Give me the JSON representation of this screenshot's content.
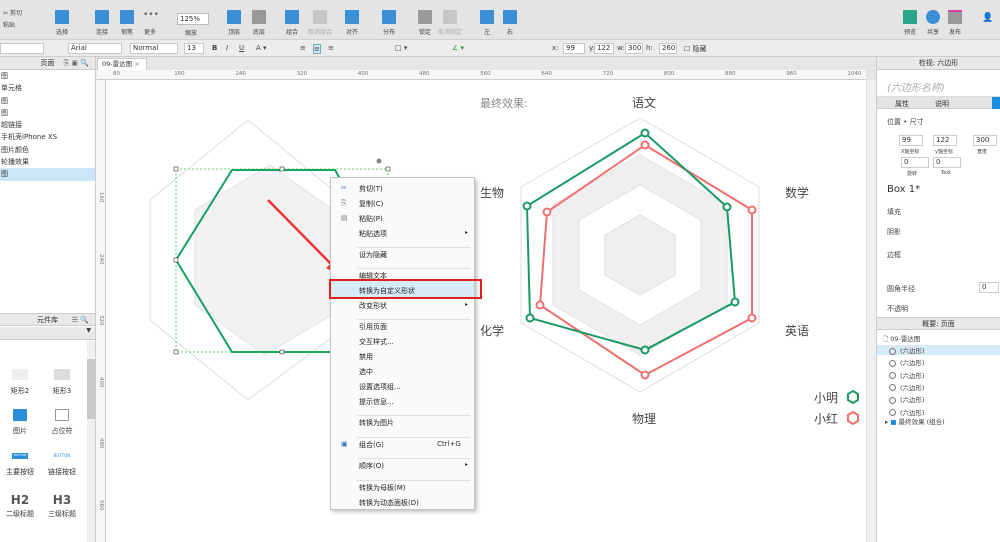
{
  "toolbar": {
    "items": [
      "选择",
      "连接",
      "钢笔",
      "更多",
      "缩放",
      "顶层",
      "底层",
      "组合",
      "取消组合",
      "对齐",
      "分布",
      "锁定",
      "取消锁定",
      "左",
      "右",
      "预览",
      "共享",
      "发布"
    ],
    "zoom": "125%",
    "edit_cut": "剪切",
    "edit_paste": "粘贴"
  },
  "format": {
    "font": "Arial",
    "weight": "Normal",
    "size": "13",
    "x_label": "x:",
    "x": "99",
    "y_label": "y:",
    "y": "122",
    "w_label": "w:",
    "w": "300",
    "h_label": "h:",
    "h": "260",
    "hidden_label": "隐藏"
  },
  "pages": {
    "title": "页面",
    "items": [
      "图",
      "单元格",
      "图",
      "图",
      "超链接",
      "手机壳iPhone XS",
      "图片颜色",
      "轮播效果",
      "图"
    ],
    "selected": 8
  },
  "library": {
    "title": "元件库",
    "items": [
      "矩形2",
      "矩形3",
      "图片",
      "占位符",
      "主要按钮",
      "链接按钮",
      "二级标题",
      "三级标题"
    ],
    "h2": "H2",
    "h3": "H3",
    "btn": "BUTTON"
  },
  "canvas": {
    "tab": "09-雷达图",
    "ruler_h": [
      "80",
      "160",
      "240",
      "320",
      "400",
      "480",
      "560",
      "640",
      "720",
      "800",
      "880",
      "960",
      "1040"
    ],
    "ruler_v": [
      "160",
      "240",
      "320",
      "400",
      "480",
      "560"
    ]
  },
  "radar": {
    "title": "最终效果:",
    "axes": [
      "语文",
      "数学",
      "英语",
      "物理",
      "化学",
      "生物"
    ],
    "legend": [
      {
        "name": "小明",
        "color": "#1a9a64"
      },
      {
        "name": "小红",
        "color": "#f07070"
      }
    ]
  },
  "context_menu": {
    "items": [
      "剪切(T)",
      "复制(C)",
      "粘贴(P)",
      "粘贴选项",
      "设为隐藏",
      "编辑文本",
      "转换为自定义形状",
      "改变形状",
      "引用页面",
      "交互样式...",
      "禁用",
      "选中",
      "设置选项组...",
      "提示信息...",
      "转换为图片",
      "组合(G)",
      "顺序(O)",
      "转换为母板(M)",
      "转换为动态面板(D)"
    ],
    "shortcut_group": "Ctrl+G",
    "highlighted": "转换为自定义形状"
  },
  "inspector": {
    "title": "检视: 六边形",
    "name_placeholder": "(六边形名称)",
    "tabs": [
      "属性",
      "说明"
    ],
    "section": "位置 • 尺寸",
    "x": "99",
    "y": "122",
    "w": "300",
    "x_lbl": "X轴坐标",
    "y_lbl": "y轴坐标",
    "w_lbl": "宽度",
    "rot": "0",
    "text_rot": "0",
    "rot_lbl": "旋转",
    "text_lbl": "Text",
    "style": "Box 1*",
    "fill": "填充",
    "shadow": "阴影",
    "border": "边框",
    "radius": "圆角半径",
    "radius_val": "0",
    "opacity": "不透明"
  },
  "outline": {
    "title": "概要: 页面",
    "page": "09-雷达图",
    "items": [
      "(六边形)",
      "(六边形)",
      "(六边形)",
      "(六边形)",
      "(六边形)",
      "(六边形)"
    ],
    "group": "最终效果 (组合)"
  }
}
